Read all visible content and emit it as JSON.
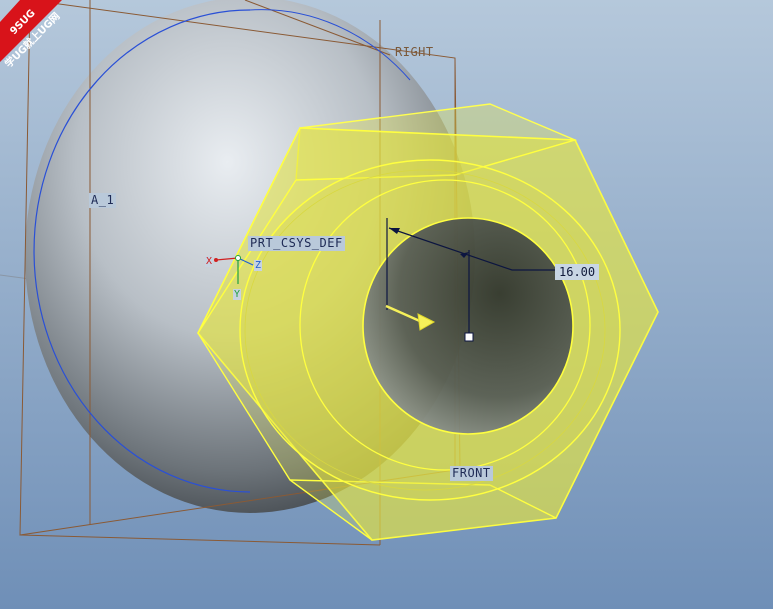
{
  "watermark": {
    "line1": "9SUG",
    "line2": "学UG就上UG网",
    "colors": {
      "ribbon": "#d8131a",
      "text": "#ffffff"
    }
  },
  "datums": {
    "right_plane": "RIGHT",
    "front_plane": "FRONT",
    "axis": "A_1",
    "csys": "PRT_CSYS_DEF"
  },
  "csys_axes": {
    "x": "X",
    "y": "Y",
    "z": "Z"
  },
  "dimension": {
    "value": "16.00"
  },
  "colors": {
    "background_top": "#b5c8db",
    "background_bottom": "#6f8fb7",
    "sphere_light": "#e6eaef",
    "sphere_dark": "#3b4044",
    "nut_fill": "#e3e43a",
    "nut_edge": "#ffff40",
    "datum_plane": "#8a5a35",
    "sketch_circle": "#2a50d6",
    "dimension_line": "#0c1540",
    "drag_arrow": "#f5f05a"
  }
}
